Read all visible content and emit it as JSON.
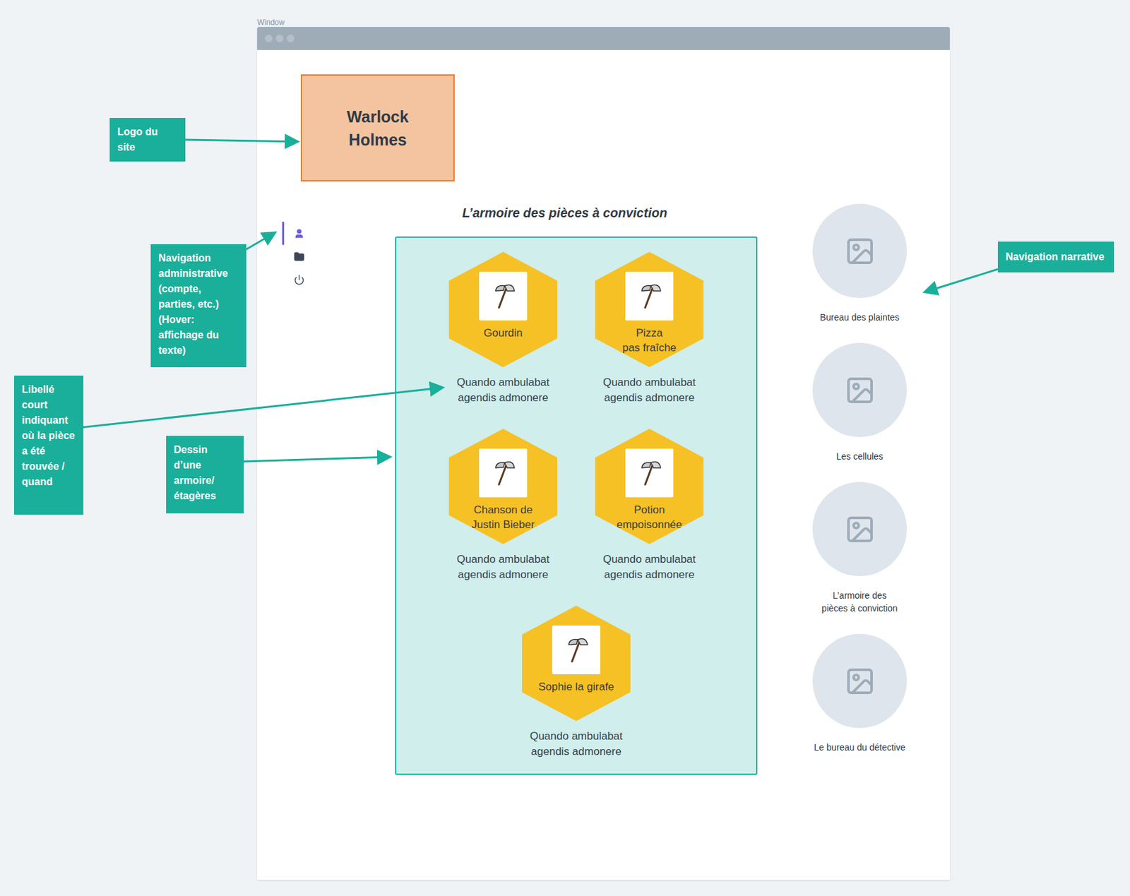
{
  "canvas_label": "Window",
  "logo": {
    "lines": [
      "Warlock",
      "Holmes"
    ]
  },
  "admin_nav": {
    "items": [
      {
        "selected": true
      },
      {
        "selected": false
      },
      {
        "selected": false
      }
    ]
  },
  "cabinet": {
    "title": "L’armoire des pièces à conviction",
    "items": [
      {
        "name": [
          "Gourdin"
        ],
        "caption": [
          "Quando ambulabat",
          "agendis admonere"
        ]
      },
      {
        "name": [
          "Pizza",
          "pas fraîche"
        ],
        "caption": [
          "Quando ambulabat",
          "agendis admonere"
        ]
      },
      {
        "name": [
          "Chanson de",
          "Justin Bieber"
        ],
        "caption": [
          "Quando ambulabat",
          "agendis admonere"
        ]
      },
      {
        "name": [
          "Potion",
          "empoisonnée"
        ],
        "caption": [
          "Quando ambulabat",
          "agendis admonere"
        ]
      },
      {
        "name": [
          "Sophie la girafe"
        ],
        "caption": [
          "Quando ambulabat",
          "agendis admonere"
        ]
      }
    ]
  },
  "narrative_nav": {
    "items": [
      {
        "label": [
          "Bureau des plaintes"
        ]
      },
      {
        "label": [
          "Les cellules"
        ]
      },
      {
        "label": [
          "L’armoire des",
          "pièces à conviction"
        ]
      },
      {
        "label": [
          "Le bureau du détective"
        ]
      }
    ]
  },
  "annotations": [
    {
      "text": "Logo du site"
    },
    {
      "text": "Navigation administrative (compte, parties, etc.) (Hover: affichage du texte)"
    },
    {
      "text": "Libellé court indiquant où la pièce a été trouvée / quand"
    },
    {
      "text": "Dessin d’une armoire/étagères"
    },
    {
      "text": "Navigation narrative"
    }
  ]
}
